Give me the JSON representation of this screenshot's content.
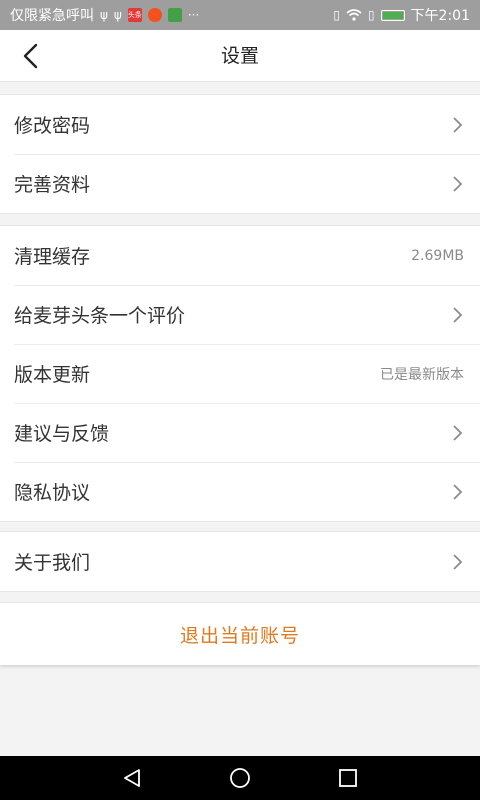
{
  "status_bar": {
    "carrier": "仅限紧急呼叫",
    "notif_badge_1": "头条",
    "time": "下午2:01",
    "icons": [
      "usb-icon",
      "usb-icon",
      "news-app-icon",
      "weibo-app-icon",
      "play-app-icon",
      "more-icon",
      "vibrate-icon",
      "wifi-icon",
      "sim-icon",
      "battery-icon"
    ]
  },
  "header": {
    "title": "设置"
  },
  "groups": [
    {
      "items": [
        {
          "label": "修改密码"
        },
        {
          "label": "完善资料"
        }
      ]
    },
    {
      "items": [
        {
          "label": "清理缓存",
          "value": "2.69MB"
        },
        {
          "label": "给麦芽头条一个评价"
        },
        {
          "label": "版本更新",
          "value": "已是最新版本"
        },
        {
          "label": "建议与反馈"
        },
        {
          "label": "隐私协议"
        }
      ]
    },
    {
      "items": [
        {
          "label": "关于我们"
        }
      ]
    }
  ],
  "logout": {
    "label": "退出当前账号"
  },
  "colors": {
    "accent": "#e07a1f",
    "status_bar": "#9e9e9e",
    "background": "#f3f3f3"
  }
}
